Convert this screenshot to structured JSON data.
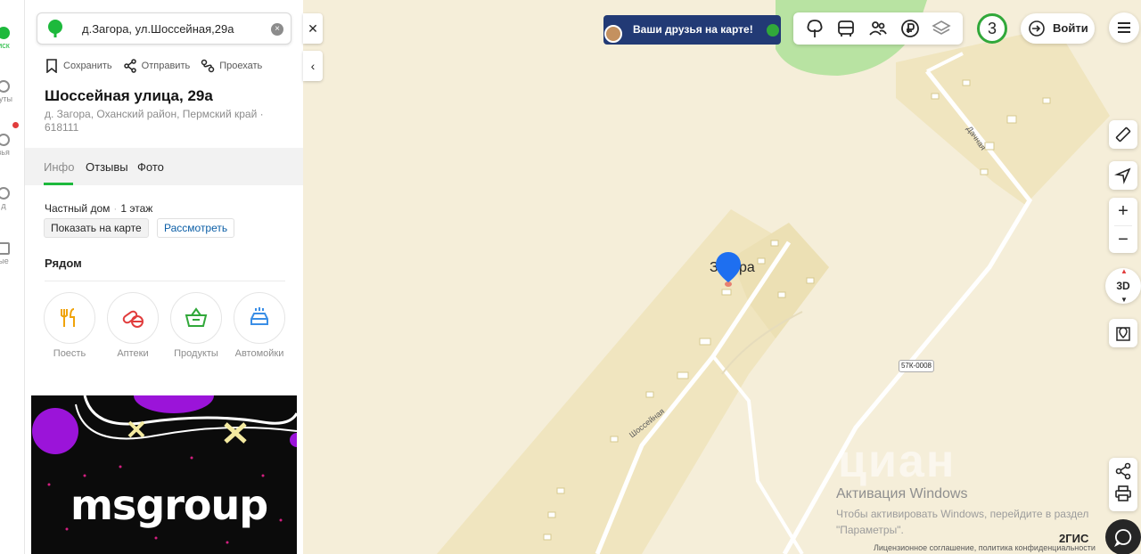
{
  "left_rail": {
    "items": [
      {
        "label": "иск",
        "icon": "search-icon"
      },
      {
        "label": "руты",
        "icon": "route-icon"
      },
      {
        "label": "зья",
        "icon": "friends-icon"
      },
      {
        "label": "д",
        "icon": "star-icon"
      },
      {
        "label": "ые",
        "icon": "building-icon"
      }
    ],
    "accent": "#1db93c"
  },
  "search": {
    "value": "д.Загора, ул.Шоссейная,29а",
    "clear_icon": "clear-icon"
  },
  "actions": {
    "save": "Сохранить",
    "share": "Отправить",
    "route": "Проехать"
  },
  "place": {
    "title": "Шоссейная улица, 29а",
    "address": "д. Загора, Оханский район, Пермский край · 618111"
  },
  "tabs": [
    {
      "label": "Инфо",
      "active": true
    },
    {
      "label": "Отзывы",
      "active": false
    },
    {
      "label": "Фото",
      "active": false
    }
  ],
  "building": {
    "type": "Частный дом",
    "floors": "1 этаж"
  },
  "buttons": {
    "show_on_map": "Показать на карте",
    "consider": "Рассмотреть"
  },
  "nearby": {
    "heading": "Рядом",
    "categories": [
      {
        "label": "Поесть",
        "icon": "food-icon",
        "color": "#f0a30a"
      },
      {
        "label": "Аптеки",
        "icon": "pharmacy-icon",
        "color": "#e13c3c"
      },
      {
        "label": "Продукты",
        "icon": "grocery-icon",
        "color": "#31a83a"
      },
      {
        "label": "Автомойки",
        "icon": "carwash-icon",
        "color": "#3a8ee6"
      }
    ]
  },
  "ad": {
    "logo_text": "msgroup",
    "colors": [
      "#9b14d9",
      "#0b0b0b"
    ]
  },
  "map": {
    "friends_banner": "Ваши друзья на карте!",
    "counter": "3",
    "login": "Войти",
    "place_label": "Загора",
    "road_label": "57К-0008",
    "streets": {
      "shosseynaya": "Шоссейная",
      "dachnaya": "Дачная"
    },
    "zoom_in": "+",
    "zoom_out": "−",
    "three_d": "3D",
    "watermark": "циан",
    "activation_title": "Активация Windows",
    "activation_line1": "Чтобы активировать Windows, перейдите в раздел",
    "activation_line2": "\"Параметры\".",
    "brand": "2ГИС",
    "legal": "Лицензионное соглашение, политика конфиденциальности",
    "colors": {
      "background": "#f5eed9",
      "settlement": "#f0e5bf",
      "forest": "#b8e3a2",
      "marker": "#1e6ff0"
    }
  }
}
